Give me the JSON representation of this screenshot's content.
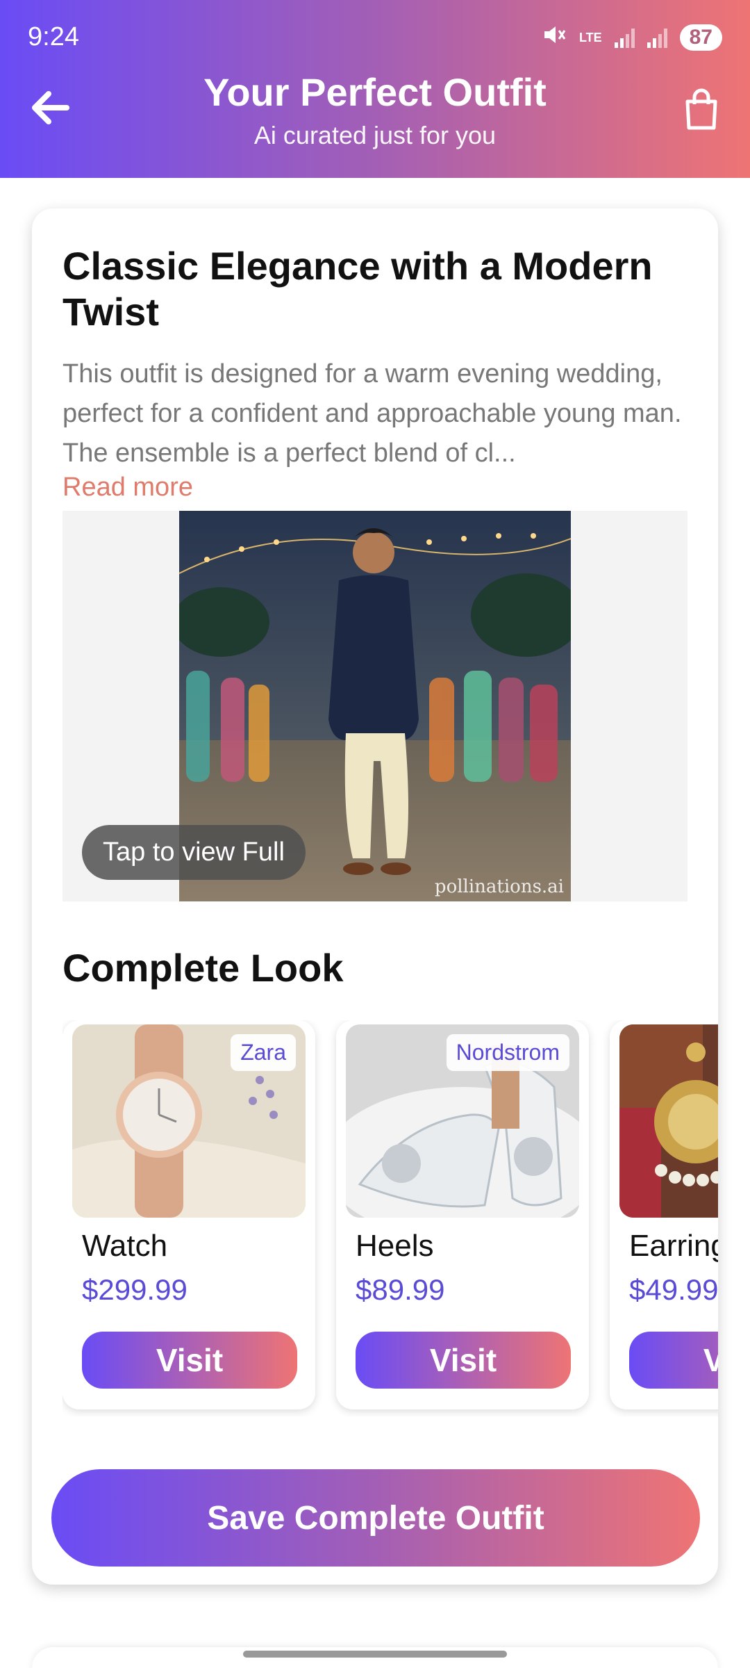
{
  "status_bar": {
    "time": "9:24",
    "network": "LTE",
    "battery": "87"
  },
  "header": {
    "title": "Your Perfect Outfit",
    "subtitle": "Ai curated just for you"
  },
  "outfit": {
    "title": "Classic Elegance with a Modern Twist",
    "description": "This outfit is designed for a warm evening wedding, perfect for a confident and approachable young man. The ensemble is a perfect blend of cl...",
    "read_more": "Read more",
    "tap_to_view": "Tap to view Full",
    "watermark": "pollinations.ai"
  },
  "complete_look": {
    "title": "Complete Look",
    "visit_label": "Visit",
    "items": [
      {
        "brand": "Zara",
        "name": "Watch",
        "price": "$299.99"
      },
      {
        "brand": "Nordstrom",
        "name": "Heels",
        "price": "$89.99"
      },
      {
        "brand": "",
        "name": "Earrings",
        "price": "$49.99"
      }
    ]
  },
  "save_button": "Save Complete Outfit",
  "colors": {
    "gradient_start": "#6a4cf5",
    "gradient_end": "#ee7474",
    "accent_text": "#5a4bd6",
    "read_more": "#e07a6a"
  },
  "icons": {
    "back": "arrow-left-icon",
    "bag": "shopping-bag-icon",
    "mute": "mute-icon",
    "signal": "signal-icon"
  }
}
